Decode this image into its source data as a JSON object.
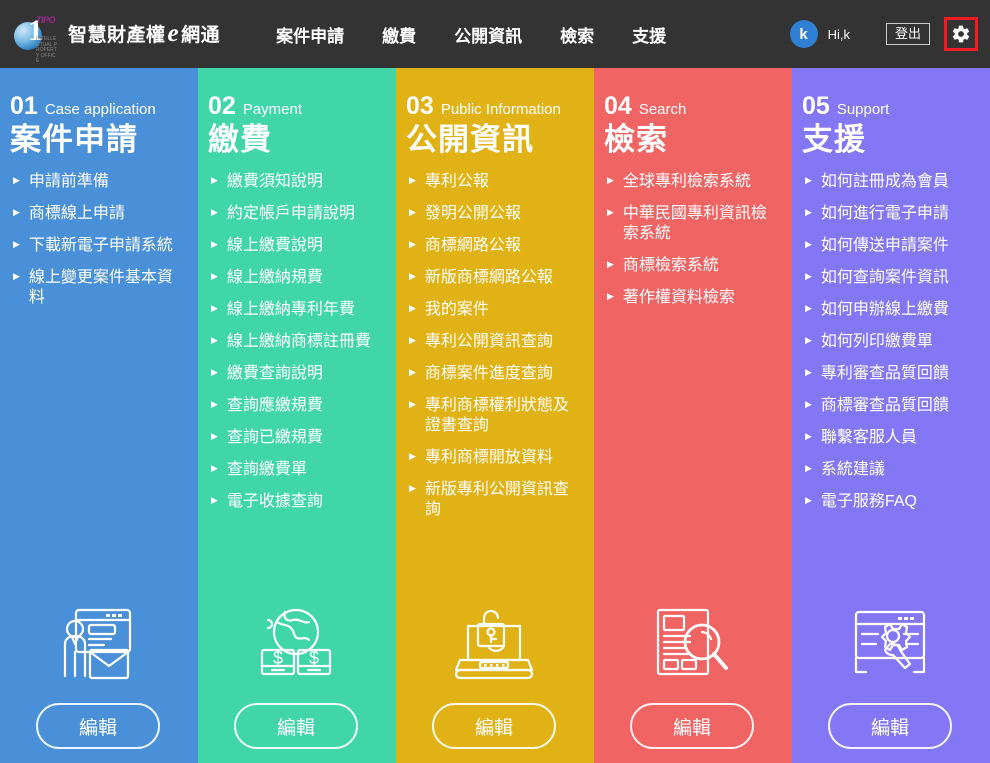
{
  "header": {
    "logo": {
      "mark_digit": "1",
      "mark_badge": "TIPO",
      "mark_sub": "INTELLECTUAL PROPERTY OFFICE",
      "text_before": "智慧財產權",
      "text_e": "e",
      "text_after": "網通"
    },
    "nav": [
      {
        "label": "案件申請"
      },
      {
        "label": "繳費"
      },
      {
        "label": "公開資訊"
      },
      {
        "label": "檢索"
      },
      {
        "label": "支援"
      }
    ],
    "avatar_initial": "k",
    "greeting": "Hi,k",
    "logout_label": "登出",
    "gear_icon": "gear-icon",
    "highlight_color": "#ee1c25"
  },
  "columns": [
    {
      "number": "01",
      "english": "Case application",
      "chinese": "案件申請",
      "color": "#4a90d9",
      "icon": "person-presentation-mail-icon",
      "edit_label": "編輯",
      "links": [
        "申請前準備",
        "商標線上申請",
        "下載新電子申請系統",
        "線上變更案件基本資料"
      ]
    },
    {
      "number": "02",
      "english": "Payment",
      "chinese": "繳費",
      "color": "#40d6a8",
      "icon": "globe-money-icon",
      "edit_label": "編輯",
      "links": [
        "繳費須知說明",
        "約定帳戶申請說明",
        "線上繳費說明",
        "線上繳納規費",
        "線上繳納專利年費",
        "線上繳納商標註冊費",
        "繳費查詢說明",
        "查詢應繳規費",
        "查詢已繳規費",
        "查詢繳費單",
        "電子收據查詢"
      ]
    },
    {
      "number": "03",
      "english": "Public Information",
      "chinese": "公開資訊",
      "color": "#e0b215",
      "icon": "laptop-unlock-icon",
      "edit_label": "編輯",
      "links": [
        "專利公報",
        "發明公開公報",
        "商標網路公報",
        "新版商標網路公報",
        "我的案件",
        "專利公開資訊查詢",
        "商標案件進度查詢",
        "專利商標權利狀態及證書查詢",
        "專利商標開放資料",
        "新版專利公開資訊查詢"
      ]
    },
    {
      "number": "04",
      "english": "Search",
      "chinese": "檢索",
      "color": "#f06464",
      "icon": "document-magnifier-icon",
      "edit_label": "編輯",
      "links": [
        "全球專利檢索系統",
        "中華民國專利資訊檢索系統",
        "商標檢索系統",
        "著作權資料檢索"
      ]
    },
    {
      "number": "05",
      "english": "Support",
      "chinese": "支援",
      "color": "#8477f5",
      "icon": "browser-gear-wrench-icon",
      "edit_label": "編輯",
      "links": [
        "如何註冊成為會員",
        "如何進行電子申請",
        "如何傳送申請案件",
        "如何查詢案件資訊",
        "如何申辦線上繳費",
        "如何列印繳費單",
        "專利審查品質回饋",
        "商標審查品質回饋",
        "聯繫客服人員",
        "系統建議",
        "電子服務FAQ"
      ]
    }
  ]
}
